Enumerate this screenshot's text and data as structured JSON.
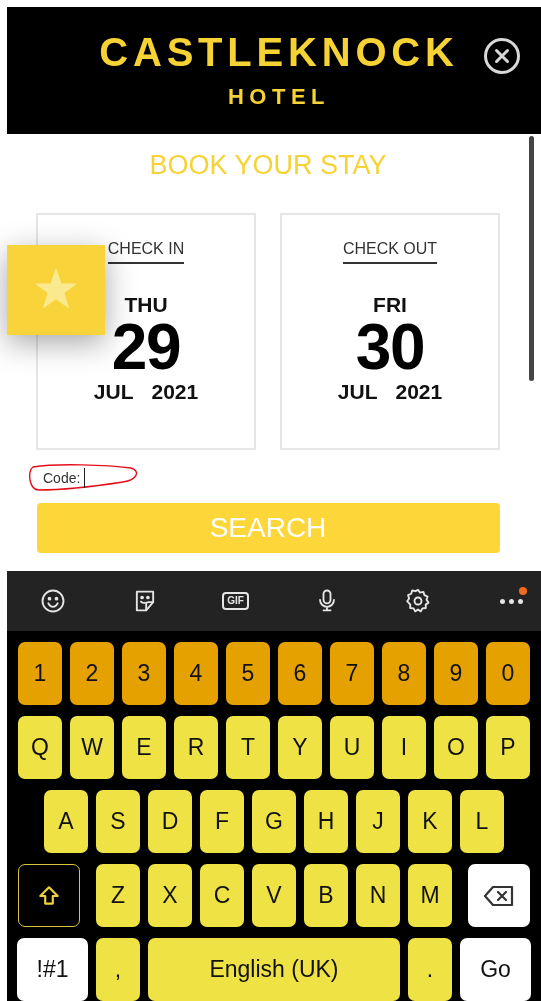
{
  "header": {
    "brand": "CASTLEKNOCK",
    "subtitle": "HOTEL"
  },
  "booking": {
    "title": "BOOK YOUR STAY",
    "dates": [
      {
        "label": "CHECK IN",
        "weekday": "THU",
        "day": "29",
        "month": "JUL",
        "year": "2021"
      },
      {
        "label": "CHECK OUT",
        "weekday": "FRI",
        "day": "30",
        "month": "JUL",
        "year": "2021"
      }
    ],
    "code_label": "Code:",
    "search_button": "SEARCH"
  },
  "keyboard_toolbar": [
    {
      "kind": "emoji"
    },
    {
      "kind": "sticker"
    },
    {
      "kind": "gif",
      "label": "GIF"
    },
    {
      "kind": "mic"
    },
    {
      "kind": "settings"
    },
    {
      "kind": "more",
      "badge": true
    }
  ],
  "keyboard": {
    "rows": [
      [
        {
          "kind": "number",
          "label": "1"
        },
        {
          "kind": "number",
          "label": "2"
        },
        {
          "kind": "number",
          "label": "3"
        },
        {
          "kind": "number",
          "label": "4"
        },
        {
          "kind": "number",
          "label": "5"
        },
        {
          "kind": "number",
          "label": "6"
        },
        {
          "kind": "number",
          "label": "7"
        },
        {
          "kind": "number",
          "label": "8"
        },
        {
          "kind": "number",
          "label": "9"
        },
        {
          "kind": "number",
          "label": "0"
        }
      ],
      [
        {
          "kind": "letter",
          "label": "Q"
        },
        {
          "kind": "letter",
          "label": "W"
        },
        {
          "kind": "letter",
          "label": "E"
        },
        {
          "kind": "letter",
          "label": "R"
        },
        {
          "kind": "letter",
          "label": "T"
        },
        {
          "kind": "letter",
          "label": "Y"
        },
        {
          "kind": "letter",
          "label": "U"
        },
        {
          "kind": "letter",
          "label": "I"
        },
        {
          "kind": "letter",
          "label": "O"
        },
        {
          "kind": "letter",
          "label": "P"
        }
      ],
      [
        {
          "kind": "letter",
          "label": "A"
        },
        {
          "kind": "letter",
          "label": "S"
        },
        {
          "kind": "letter",
          "label": "D"
        },
        {
          "kind": "letter",
          "label": "F"
        },
        {
          "kind": "letter",
          "label": "G"
        },
        {
          "kind": "letter",
          "label": "H"
        },
        {
          "kind": "letter",
          "label": "J"
        },
        {
          "kind": "letter",
          "label": "K"
        },
        {
          "kind": "letter",
          "label": "L"
        }
      ],
      [
        {
          "kind": "shift"
        },
        {
          "kind": "letter",
          "label": "Z"
        },
        {
          "kind": "letter",
          "label": "X"
        },
        {
          "kind": "letter",
          "label": "C"
        },
        {
          "kind": "letter",
          "label": "V"
        },
        {
          "kind": "letter",
          "label": "B"
        },
        {
          "kind": "letter",
          "label": "N"
        },
        {
          "kind": "letter",
          "label": "M"
        },
        {
          "kind": "backspace"
        }
      ],
      [
        {
          "kind": "symbols",
          "label": "!#1"
        },
        {
          "kind": "letter",
          "label": ","
        }
      ]
    ],
    "space_bar": {
      "label": "English (UK)"
    },
    "bottom_right": [
      {
        "kind": "letter",
        "label": "."
      },
      {
        "kind": "go",
        "label": "Go"
      }
    ]
  }
}
